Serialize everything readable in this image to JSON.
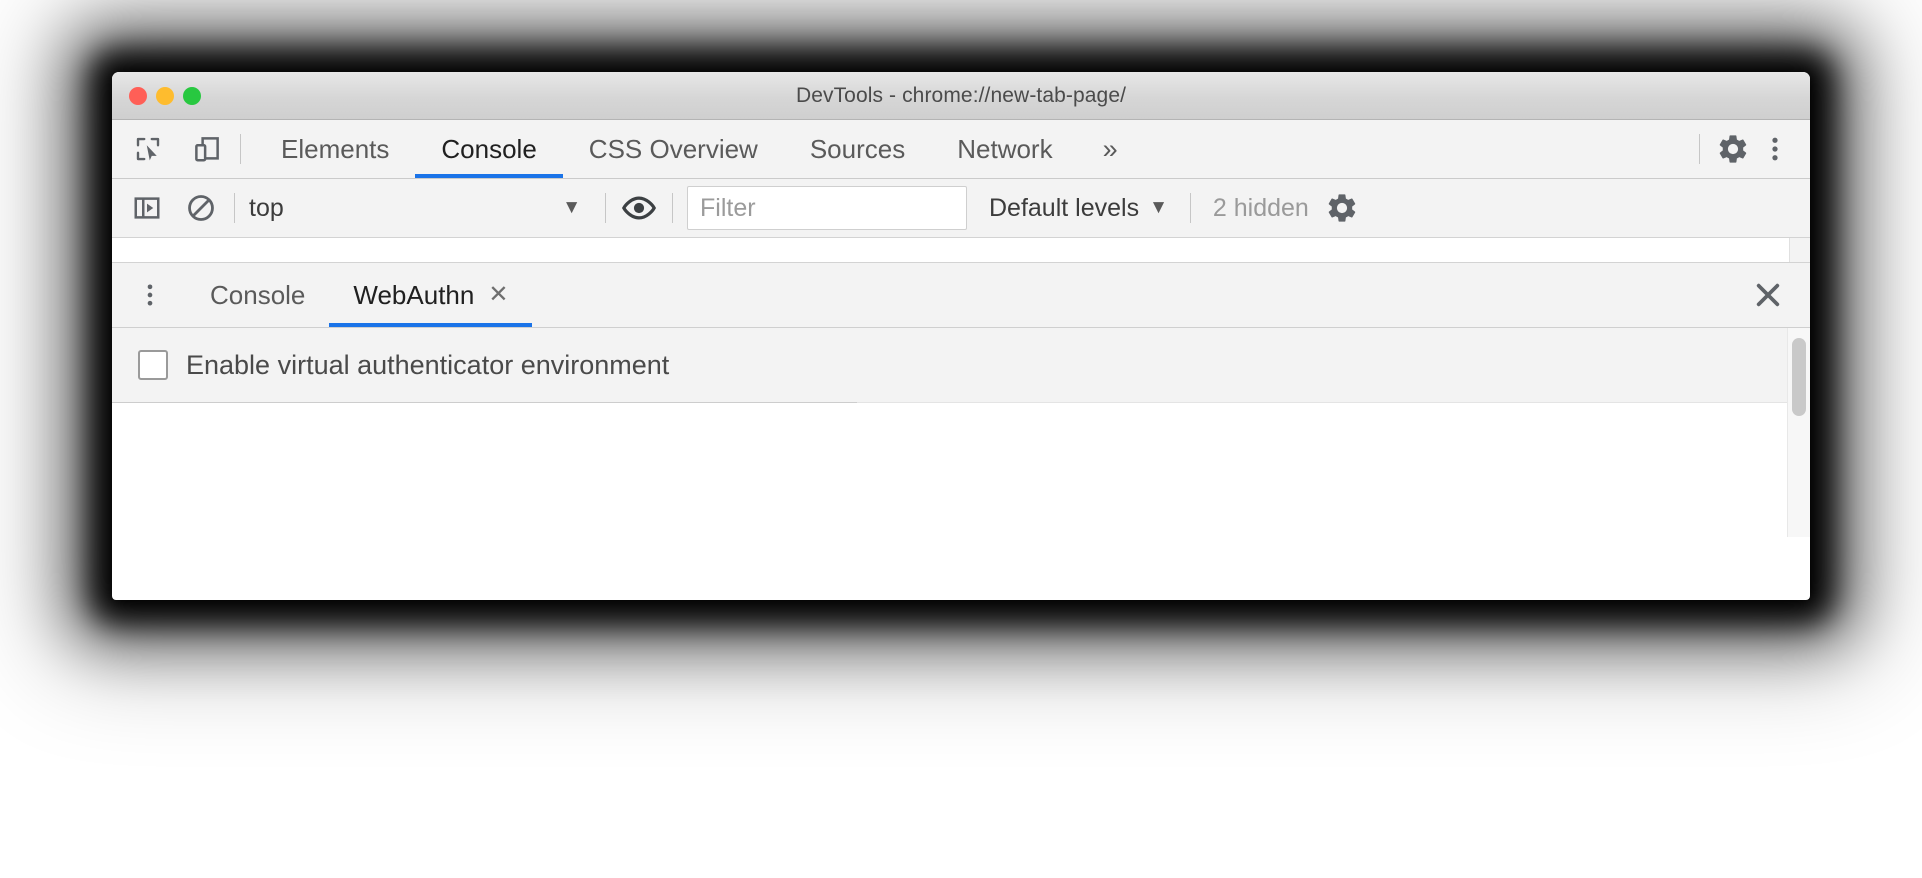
{
  "window": {
    "title": "DevTools - chrome://new-tab-page/",
    "traffic_lights": {
      "close_label": "close",
      "minimize_label": "minimize",
      "maximize_label": "maximize",
      "close_color": "#ff5f57",
      "minimize_color": "#febc2e",
      "maximize_color": "#28c840"
    }
  },
  "toolbar": {
    "inspect_icon": "inspect-element-icon",
    "device_icon": "device-toolbar-icon",
    "settings_icon": "gear-icon",
    "more_icon": "kebab-menu-icon",
    "overflow_label": "»"
  },
  "main_tabs": [
    {
      "label": "Elements",
      "selected": false
    },
    {
      "label": "Console",
      "selected": true
    },
    {
      "label": "CSS Overview",
      "selected": false
    },
    {
      "label": "Sources",
      "selected": false
    },
    {
      "label": "Network",
      "selected": false
    }
  ],
  "filter_bar": {
    "sidebar_icon": "console-sidebar-icon",
    "clear_icon": "clear-console-icon",
    "context_selected": "top",
    "context_arrow": "▼",
    "eye_icon": "live-expression-icon",
    "filter_placeholder": "Filter",
    "filter_value": "",
    "levels_label": "Default levels",
    "levels_arrow": "▼",
    "hidden_count": "2 hidden",
    "settings_icon": "gear-icon"
  },
  "drawer": {
    "kebab_icon": "more-tools-icon",
    "close_icon": "close-drawer-icon",
    "tabs": [
      {
        "label": "Console",
        "selected": false,
        "closable": false
      },
      {
        "label": "WebAuthn",
        "selected": true,
        "closable": true,
        "close_glyph": "✕"
      }
    ]
  },
  "webauthn": {
    "enable_label": "Enable virtual authenticator environment",
    "enable_checked": false
  },
  "colors": {
    "accent": "#1a73e8",
    "toolbar_bg": "#f3f3f3",
    "panel_bg": "#ffffff",
    "text": "#5a5a5a",
    "muted_text": "#9a9a9a"
  }
}
